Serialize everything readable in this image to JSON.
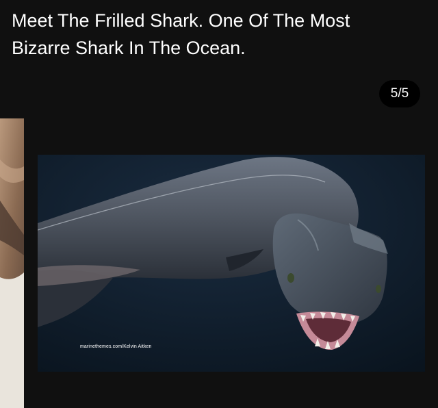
{
  "post": {
    "title": "Meet The Frilled Shark. One Of The Most Bizarre Shark In The Ocean."
  },
  "gallery": {
    "counter": "5/5",
    "image_credit": "marinethemes.com/Kelvin Aitken"
  },
  "colors": {
    "background": "#101010",
    "badge_background": "#000000",
    "text": "#ffffff",
    "photo_water": "#0d1a28"
  }
}
